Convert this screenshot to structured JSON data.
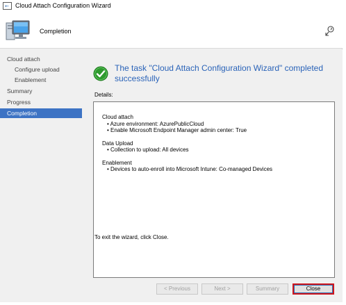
{
  "window": {
    "title": "Cloud Attach Configuration Wizard"
  },
  "header": {
    "title": "Completion",
    "icon": "computer-icon",
    "help_icon": "help-icon"
  },
  "nav": {
    "items": [
      {
        "label": "Cloud attach",
        "level": 0,
        "active": false
      },
      {
        "label": "Configure upload",
        "level": 1,
        "active": false
      },
      {
        "label": "Enablement",
        "level": 1,
        "active": false
      },
      {
        "label": "Summary",
        "level": 0,
        "active": false
      },
      {
        "label": "Progress",
        "level": 0,
        "active": false
      },
      {
        "label": "Completion",
        "level": 0,
        "active": true
      }
    ]
  },
  "main": {
    "status_text": "The task \"Cloud Attach Configuration Wizard\" completed successfully",
    "details_label": "Details:",
    "details": {
      "group1_heading": "Cloud attach",
      "group1_line1": "• Azure environment: AzurePublicCloud",
      "group1_line2": "• Enable Microsoft Endpoint Manager admin center: True",
      "group2_heading": "Data Upload",
      "group2_line1": "• Collection to upload: All devices",
      "group3_heading": "Enablement",
      "group3_line1": "• Devices to auto-enroll into Microsoft Intune: Co-managed Devices"
    },
    "exit_text": "To exit the wizard, click Close."
  },
  "footer": {
    "previous_label": "< Previous",
    "next_label": "Next >",
    "summary_label": "Summary",
    "close_label": "Close"
  },
  "colors": {
    "accent": "#3d73c4",
    "title_blue": "#2a63b8",
    "success_green": "#2e9a2e",
    "highlight_red": "#d0161c"
  }
}
